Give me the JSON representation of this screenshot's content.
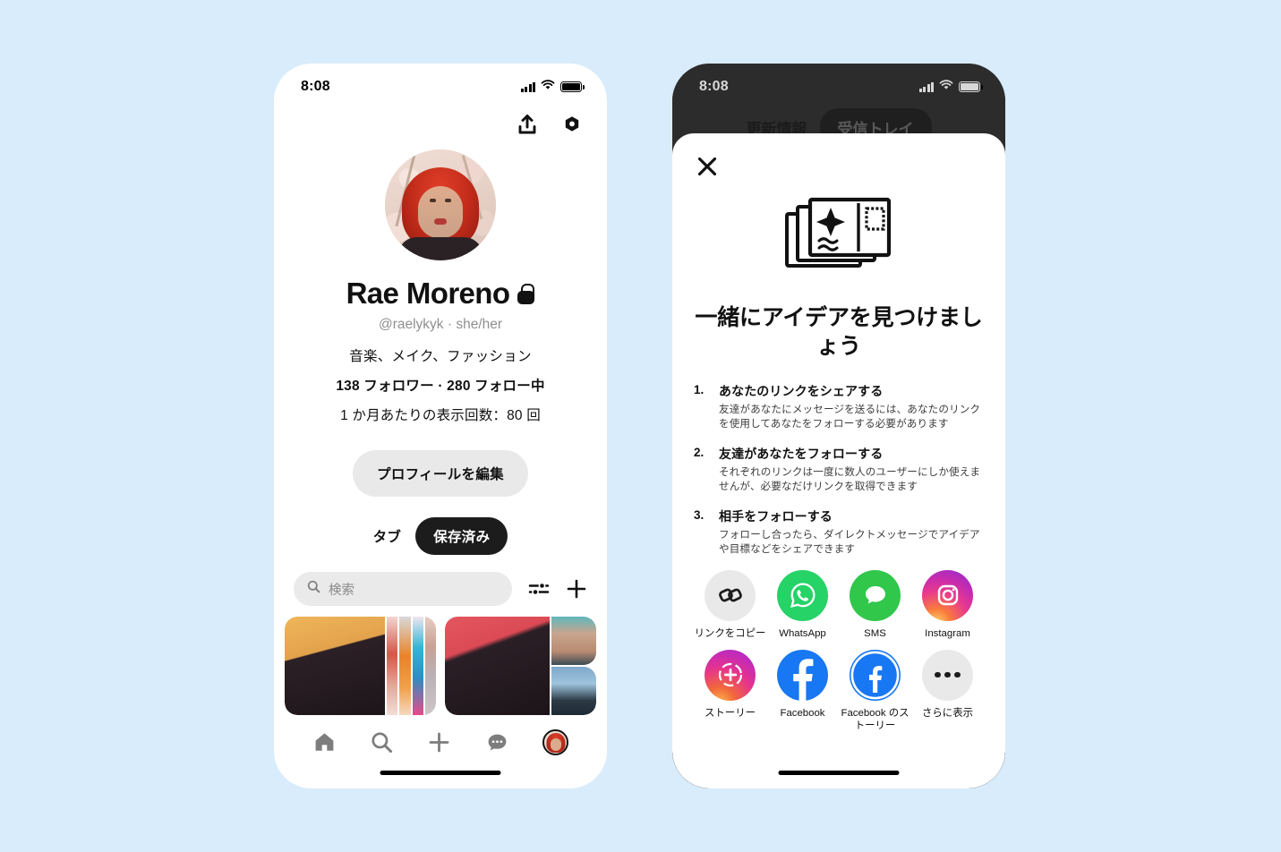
{
  "background_color": "#d9ecfb",
  "left_phone": {
    "status": {
      "time": "8:08",
      "signal_icon": "cellular-signal-icon",
      "wifi_icon": "wifi-icon",
      "battery_icon": "battery-full-icon"
    },
    "top_actions": [
      {
        "name": "share-icon",
        "label": "Share"
      },
      {
        "name": "settings-gear-icon",
        "label": "Settings"
      }
    ],
    "profile": {
      "avatar_name": "profile-avatar",
      "name": "Rae Moreno",
      "lock_icon": "lock-icon",
      "handle": "@raelykyk · she/her",
      "bio": "音楽、メイク、ファッション",
      "stats": "138 フォロワー · 280 フォロー中",
      "views": "1 か月あたりの表示回数：80 回",
      "edit_button": "プロフィールを編集"
    },
    "tabs": [
      {
        "label": "タブ",
        "active": false
      },
      {
        "label": "保存済み",
        "active": true
      }
    ],
    "search": {
      "placeholder": "検索",
      "value": "",
      "search_icon": "search-icon"
    },
    "search_actions": [
      {
        "name": "filter-sliders-icon",
        "label": "Filter"
      },
      {
        "name": "plus-icon",
        "label": "Create"
      }
    ],
    "boards": [
      {
        "name": "board-left"
      },
      {
        "name": "board-right"
      }
    ],
    "bottom_nav": [
      {
        "name": "nav-home-icon",
        "label": "Home"
      },
      {
        "name": "nav-search-icon",
        "label": "Search"
      },
      {
        "name": "nav-create-icon",
        "label": "Create"
      },
      {
        "name": "nav-messages-icon",
        "label": "Messages"
      },
      {
        "name": "nav-profile-avatar",
        "label": "Profile"
      }
    ]
  },
  "right_phone": {
    "status": {
      "time": "8:08",
      "signal_icon": "cellular-signal-icon",
      "wifi_icon": "wifi-icon",
      "battery_icon": "battery-full-icon"
    },
    "background_tabs": [
      {
        "label": "更新情報",
        "active": false
      },
      {
        "label": "受信トレイ",
        "active": true
      }
    ],
    "sheet": {
      "close_icon": "close-x-icon",
      "illustration": "postcards-icon",
      "title": "一緒にアイデアを見つけましょう",
      "steps": [
        {
          "number": "1.",
          "heading": "あなたのリンクをシェアする",
          "body": "友達があなたにメッセージを送るには、あなたのリンクを使用してあなたをフォローする必要があります"
        },
        {
          "number": "2.",
          "heading": "友達があなたをフォローする",
          "body": "それぞれのリンクは一度に数人のユーザーにしか使えませんが、必要なだけリンクを取得できます"
        },
        {
          "number": "3.",
          "heading": "相手をフォローする",
          "body": "フォローし合ったら、ダイレクトメッセージでアイデアや目標などをシェアできます"
        }
      ],
      "share_targets": [
        {
          "icon": "link-copy-icon",
          "label": "リンクをコピー",
          "color": "#e9e9e9"
        },
        {
          "icon": "whatsapp-icon",
          "label": "WhatsApp",
          "color": "#25d366"
        },
        {
          "icon": "sms-icon",
          "label": "SMS",
          "color": "#30c74b"
        },
        {
          "icon": "instagram-icon",
          "label": "Instagram",
          "color": "#e8398f"
        },
        {
          "icon": "instagram-story-icon",
          "label": "ストーリー",
          "color": "#e5328f"
        },
        {
          "icon": "facebook-icon",
          "label": "Facebook",
          "color": "#1877f2"
        },
        {
          "icon": "facebook-story-icon",
          "label": "Facebook\nのストーリー",
          "color": "#1877f2"
        },
        {
          "icon": "more-options-icon",
          "label": "さらに表示",
          "color": "#e9e9e9"
        }
      ]
    }
  }
}
